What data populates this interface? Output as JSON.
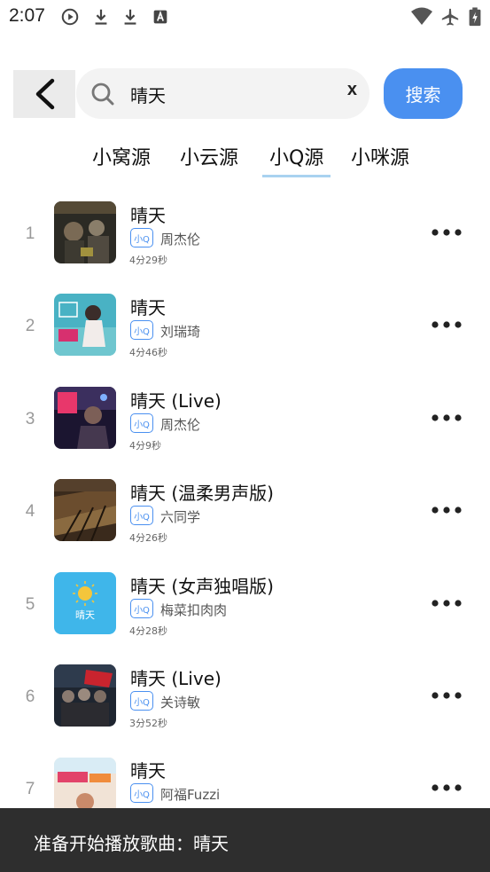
{
  "status_bar": {
    "time": "2:07",
    "left_icons": [
      "play-circle-icon",
      "download-icon",
      "download-icon",
      "font-app-icon"
    ],
    "right_icons": [
      "wifi-icon",
      "airplane-mode-icon",
      "battery-charging-icon"
    ]
  },
  "search": {
    "back_icon": "chevron-left-icon",
    "query": "晴天",
    "clear_label": "x",
    "button_label": "搜索"
  },
  "tabs": [
    {
      "label": "小窝源",
      "selected": false
    },
    {
      "label": "小云源",
      "selected": false
    },
    {
      "label": "小Q源",
      "selected": true
    },
    {
      "label": "小咪源",
      "selected": false
    }
  ],
  "songs": [
    {
      "index": "1",
      "title": "晴天",
      "badge": "小Q",
      "artist": "周杰伦",
      "duration": "4分29秒"
    },
    {
      "index": "2",
      "title": "晴天",
      "badge": "小Q",
      "artist": "刘瑞琦",
      "duration": "4分46秒"
    },
    {
      "index": "3",
      "title": "晴天 (Live)",
      "badge": "小Q",
      "artist": "周杰伦",
      "duration": "4分9秒"
    },
    {
      "index": "4",
      "title": "晴天 (温柔男声版)",
      "badge": "小Q",
      "artist": "六同学",
      "duration": "4分26秒"
    },
    {
      "index": "5",
      "title": "晴天 (女声独唱版)",
      "badge": "小Q",
      "artist": "梅菜扣肉肉",
      "duration": "4分28秒"
    },
    {
      "index": "6",
      "title": "晴天 (Live)",
      "badge": "小Q",
      "artist": "关诗敏",
      "duration": "3分52秒"
    },
    {
      "index": "7",
      "title": "晴天",
      "badge": "小Q",
      "artist": "阿福Fuzzi",
      "duration": ""
    }
  ],
  "cover_text": {
    "song5": "晴天"
  },
  "toast": {
    "message": "准备开始播放歌曲：晴天"
  },
  "colors": {
    "accent": "#4a90f0",
    "tab_underline": "#a9d2f0",
    "toast_bg": "#2e2e2e"
  }
}
